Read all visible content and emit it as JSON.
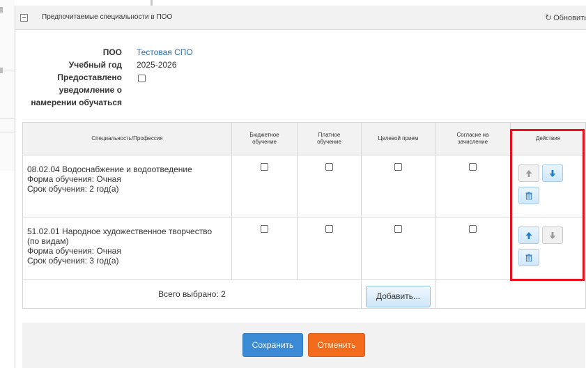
{
  "dialog": {
    "title": "Предпочитаемые специальности в ПОО",
    "refresh_label": "Обновить"
  },
  "form": {
    "poo_label": "ПОО",
    "poo_value": "Тестовая СПО",
    "year_label": "Учебный год",
    "year_value": "2025-2026",
    "notice_label_lines": [
      "Предоставлено",
      "уведомление о",
      "намерении обучаться"
    ],
    "notice_checked": false
  },
  "table": {
    "headers": {
      "specialty": "Специальность/Профессия",
      "budget": [
        "Бюджетное",
        "обучение"
      ],
      "paid": [
        "Платное",
        "обучение"
      ],
      "target": "Целевой прием",
      "consent": [
        "Согласие на",
        "зачисление"
      ],
      "actions": "Действия"
    },
    "rows": [
      {
        "lines": [
          "08.02.04 Водоснабжение и водоотведение",
          "Форма обучения: Очная",
          "Срок обучения: 2 год(а)"
        ],
        "budget": false,
        "paid": false,
        "target": false,
        "consent": false,
        "up_enabled": false,
        "down_enabled": true
      },
      {
        "lines": [
          "51.02.01 Народное художественное творчество",
          "(по видам)",
          "Форма обучения: Очная",
          "Срок обучения: 3 год(а)"
        ],
        "budget": false,
        "paid": false,
        "target": false,
        "consent": false,
        "up_enabled": true,
        "down_enabled": false
      }
    ],
    "total_label": "Всего выбрано: 2",
    "add_label": "Добавить..."
  },
  "footer": {
    "save_label": "Сохранить",
    "cancel_label": "Отменить"
  },
  "colors": {
    "highlight": "#e8101c",
    "save": "#3a8ad6",
    "cancel": "#f36b1c",
    "link": "#2a6db3",
    "arrow_active": "#1f7bd1",
    "arrow_disabled": "#9a9a9a"
  },
  "icons": {
    "collapse": "collapse-icon",
    "refresh": "refresh-icon",
    "up": "arrow-up-icon",
    "down": "arrow-down-icon",
    "delete": "trash-icon"
  }
}
